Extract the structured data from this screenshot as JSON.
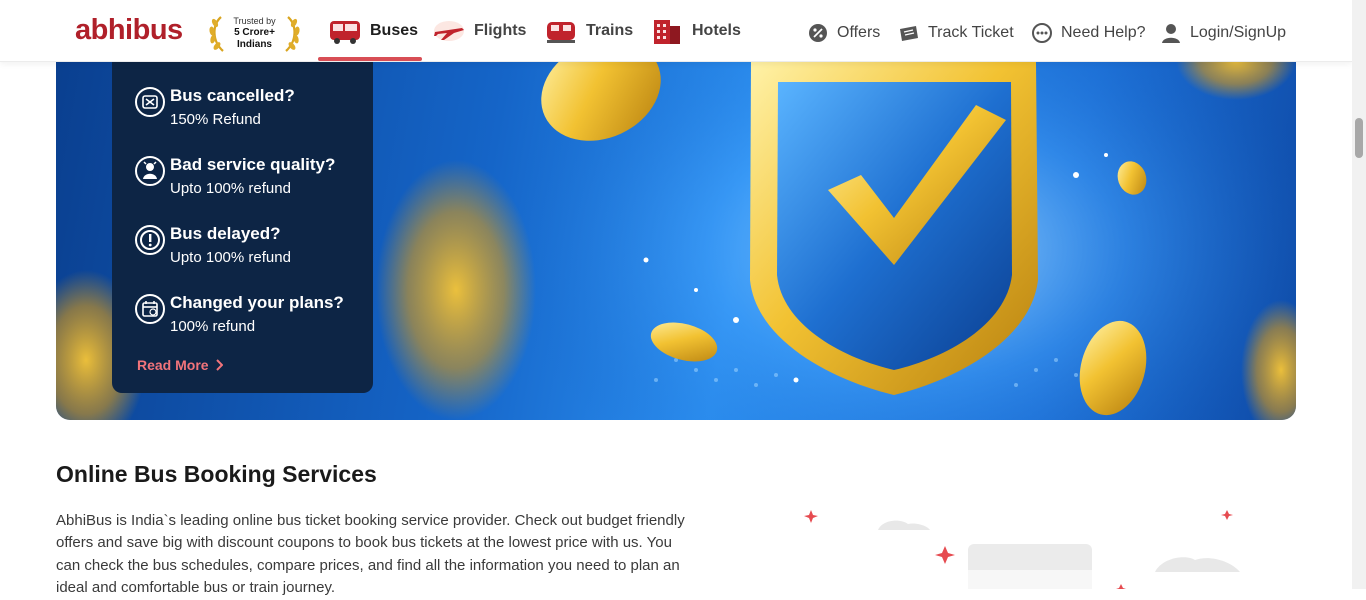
{
  "brand": {
    "logo_text": "abhibus",
    "trust_badge": {
      "line1": "Trusted by",
      "line2": "5 Crore+",
      "line3": "Indians"
    }
  },
  "nav": {
    "items": [
      {
        "label": "Buses",
        "icon": "bus-icon",
        "active": true
      },
      {
        "label": "Flights",
        "icon": "plane-icon",
        "active": false
      },
      {
        "label": "Trains",
        "icon": "train-icon",
        "active": false
      },
      {
        "label": "Hotels",
        "icon": "hotel-icon",
        "active": false
      }
    ],
    "utilities": [
      {
        "label": "Offers",
        "icon": "offer-tag-icon"
      },
      {
        "label": "Track Ticket",
        "icon": "ticket-icon"
      },
      {
        "label": "Need Help?",
        "icon": "headset-icon"
      },
      {
        "label": "Login/SignUp",
        "icon": "user-icon"
      }
    ]
  },
  "refund_card": {
    "items": [
      {
        "title": "Bus cancelled?",
        "subtitle": "150% Refund",
        "icon": "bus-cancel-icon"
      },
      {
        "title": "Bad service quality?",
        "subtitle": "Upto 100% refund",
        "icon": "thumbs-down-icon"
      },
      {
        "title": "Bus delayed?",
        "subtitle": "Upto 100% refund",
        "icon": "alert-icon"
      },
      {
        "title": "Changed your plans?",
        "subtitle": "100% refund",
        "icon": "calendar-icon"
      }
    ],
    "read_more": "Read More"
  },
  "content": {
    "title": "Online Bus Booking Services",
    "body": "AbhiBus is India`s leading online bus ticket booking service provider. Check out budget friendly offers and save big with discount coupons to book bus tickets at the lowest price with us. You can check the bus schedules, compare prices, and find all the information you need to plan an ideal and comfortable bus or train journey."
  },
  "colors": {
    "brand_red": "#b0202a",
    "accent_red": "#d84e55",
    "card_navy": "#0d2545",
    "banner_blue": "#1565c8",
    "gold": "#f2c232"
  }
}
